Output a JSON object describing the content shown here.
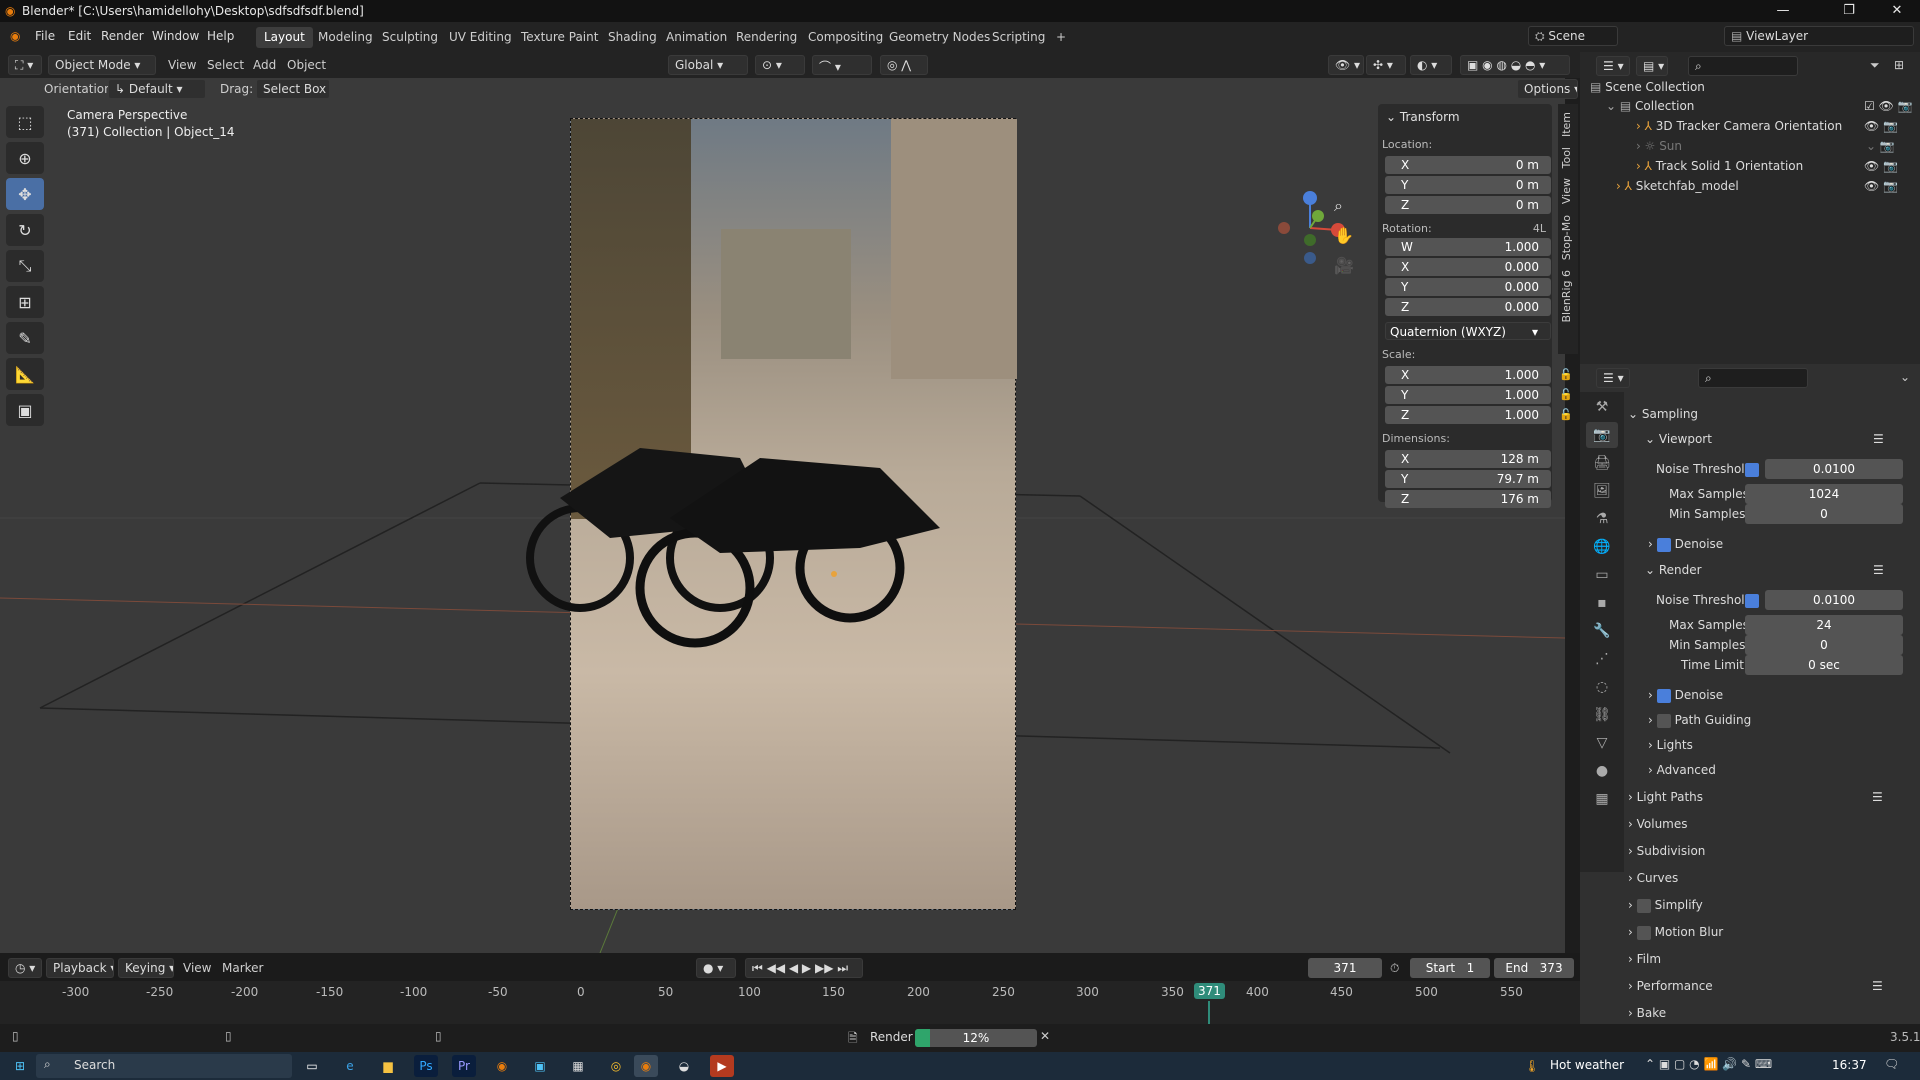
{
  "window": {
    "title": "Blender* [C:\\Users\\hamidellohy\\Desktop\\sdfsdfsdf.blend]"
  },
  "menus": [
    "File",
    "Edit",
    "Render",
    "Window",
    "Help"
  ],
  "workspaces": [
    "Layout",
    "Modeling",
    "Sculpting",
    "UV Editing",
    "Texture Paint",
    "Shading",
    "Animation",
    "Rendering",
    "Compositing",
    "Geometry Nodes",
    "Scripting"
  ],
  "active_workspace": "Layout",
  "scene": "Scene",
  "view_layer": "ViewLayer",
  "header": {
    "mode": "Object Mode",
    "view": "View",
    "select": "Select",
    "add": "Add",
    "object": "Object",
    "transform_space": "Global",
    "orientation_label": "Orientation:",
    "orientation": "Default",
    "drag_label": "Drag:",
    "drag": "Select Box",
    "options": "Options"
  },
  "viewport": {
    "camera_label": "Camera Perspective",
    "collection_label": "(371) Collection | Object_14"
  },
  "npanel": {
    "section": "Transform",
    "location_label": "Location:",
    "location": [
      {
        "k": "X",
        "v": "0 m"
      },
      {
        "k": "Y",
        "v": "0 m"
      },
      {
        "k": "Z",
        "v": "0 m"
      }
    ],
    "rotation_label": "Rotation:",
    "rotation_mode_short": "4L",
    "rotation": [
      {
        "k": "W",
        "v": "1.000"
      },
      {
        "k": "X",
        "v": "0.000"
      },
      {
        "k": "Y",
        "v": "0.000"
      },
      {
        "k": "Z",
        "v": "0.000"
      }
    ],
    "rotation_mode": "Quaternion (WXYZ)",
    "scale_label": "Scale:",
    "scale": [
      {
        "k": "X",
        "v": "1.000"
      },
      {
        "k": "Y",
        "v": "1.000"
      },
      {
        "k": "Z",
        "v": "1.000"
      }
    ],
    "dimensions_label": "Dimensions:",
    "dimensions": [
      {
        "k": "X",
        "v": "128 m"
      },
      {
        "k": "Y",
        "v": "79.7 m"
      },
      {
        "k": "Z",
        "v": "176 m"
      }
    ],
    "tabs": [
      "Item",
      "Tool",
      "View",
      "Stop-Mo",
      "BlenRig 6"
    ]
  },
  "outliner": {
    "items": [
      {
        "label": "Scene Collection",
        "depth": 0
      },
      {
        "label": "Collection",
        "depth": 1
      },
      {
        "label": "3D Tracker Camera Orientation",
        "depth": 2
      },
      {
        "label": "Sun",
        "depth": 2
      },
      {
        "label": "Track Solid 1 Orientation",
        "depth": 2
      },
      {
        "label": "Sketchfab_model",
        "depth": 1
      }
    ]
  },
  "properties": {
    "sampling": "Sampling",
    "viewport": "Viewport",
    "noise_threshold_label": "Noise Threshold",
    "vp_noise": "0.0100",
    "max_samples_label": "Max Samples",
    "vp_max": "1024",
    "min_samples_label": "Min Samples",
    "vp_min": "0",
    "denoise": "Denoise",
    "render": "Render",
    "r_noise": "0.0100",
    "r_max": "24",
    "r_min": "0",
    "time_limit_label": "Time Limit",
    "r_time": "0 sec",
    "path_guiding": "Path Guiding",
    "lights": "Lights",
    "advanced": "Advanced",
    "panels": [
      "Light Paths",
      "Volumes",
      "Subdivision",
      "Curves",
      "Simplify",
      "Motion Blur",
      "Film",
      "Performance",
      "Bake"
    ]
  },
  "timeline": {
    "playback": "Playback",
    "keying": "Keying",
    "view": "View",
    "marker": "Marker",
    "current_frame": "371",
    "start_label": "Start",
    "start": "1",
    "end_label": "End",
    "end": "373",
    "ticks": [
      "-300",
      "-250",
      "-200",
      "-150",
      "-100",
      "-50",
      "0",
      "50",
      "100",
      "150",
      "200",
      "250",
      "300",
      "350",
      "371",
      "400",
      "450",
      "500",
      "550"
    ]
  },
  "status": {
    "render_label": "Render",
    "progress_text": "12%",
    "progress": 0.12,
    "version": "3.5.1"
  },
  "taskbar": {
    "search": "Search",
    "weather": "Hot weather",
    "time": "16:37"
  }
}
